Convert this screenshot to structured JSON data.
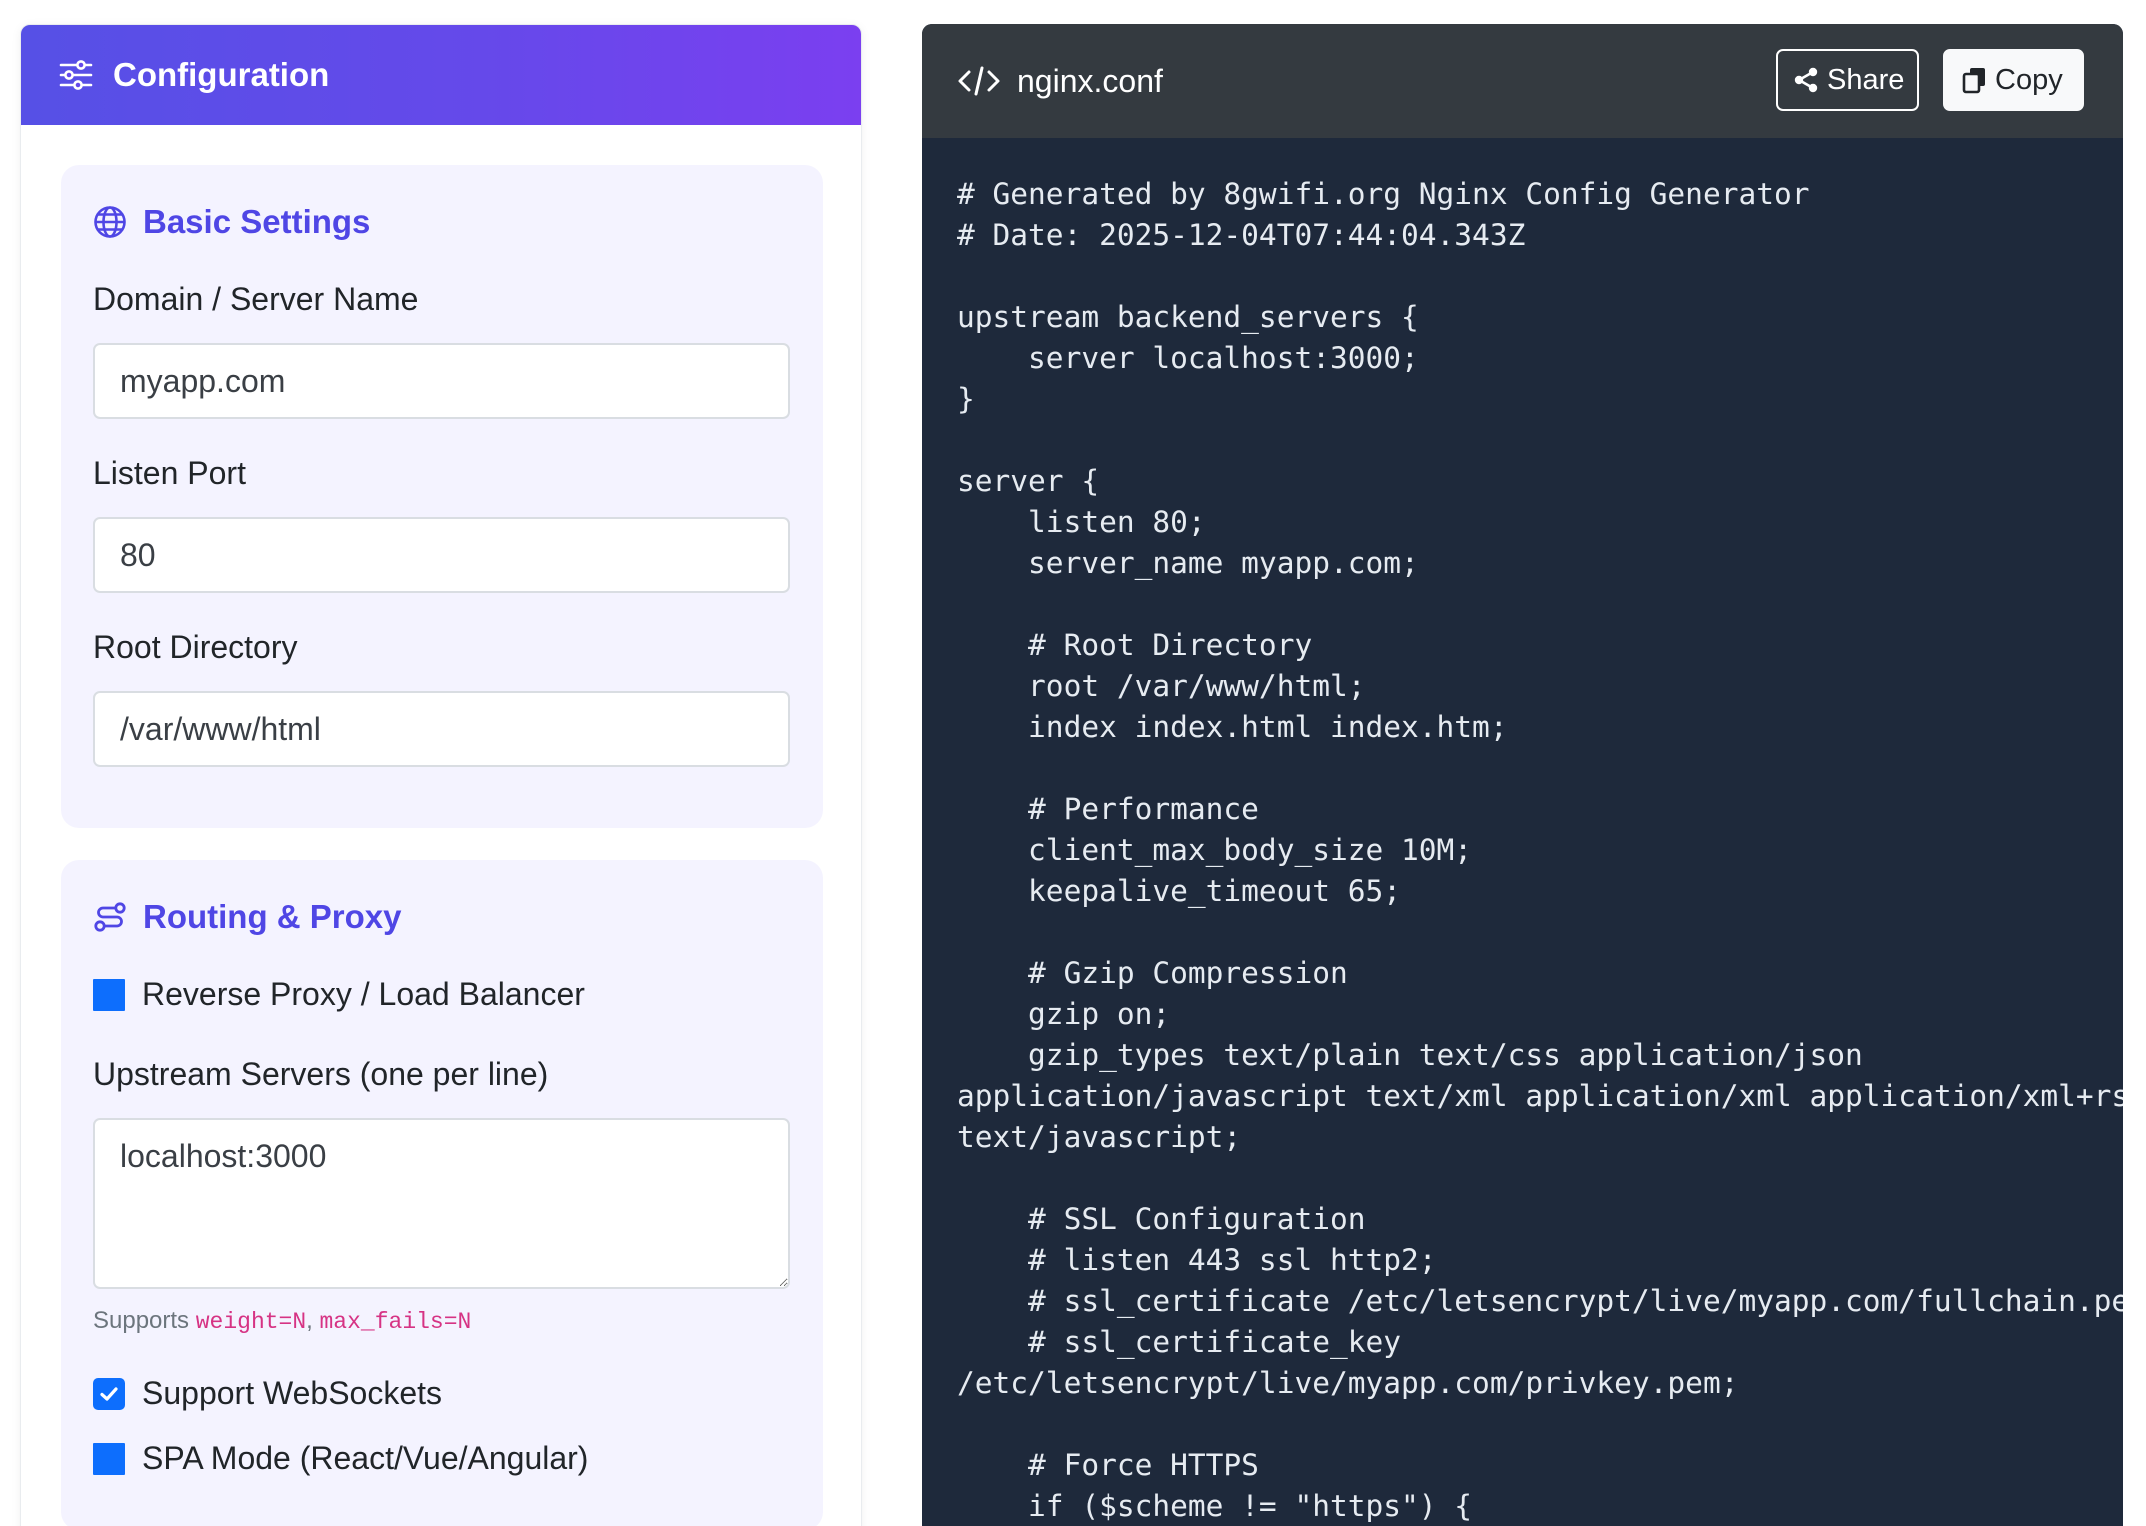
{
  "config": {
    "title": "Configuration",
    "basic": {
      "title": "Basic Settings",
      "domain_label": "Domain / Server Name",
      "domain_value": "myapp.com",
      "port_label": "Listen Port",
      "port_value": "80",
      "root_label": "Root Directory",
      "root_value": "/var/www/html"
    },
    "routing": {
      "title": "Routing & Proxy",
      "reverse_proxy_label": "Reverse Proxy / Load Balancer",
      "upstream_label": "Upstream Servers (one per line)",
      "upstream_value": "localhost:3000",
      "help_prefix": "Supports ",
      "help_code1": "weight=N",
      "help_sep": ", ",
      "help_code2": "max_fails=N",
      "websockets_label": "Support WebSockets",
      "websockets_checked": true,
      "spa_label": "SPA Mode (React/Vue/Angular)"
    }
  },
  "code": {
    "filename": "nginx.conf",
    "share_label": "Share",
    "copy_label": "Copy",
    "content": "# Generated by 8gwifi.org Nginx Config Generator\n# Date: 2025-12-04T07:44:04.343Z\n\nupstream backend_servers {\n    server localhost:3000;\n}\n\nserver {\n    listen 80;\n    server_name myapp.com;\n\n    # Root Directory\n    root /var/www/html;\n    index index.html index.htm;\n\n    # Performance\n    client_max_body_size 10M;\n    keepalive_timeout 65;\n\n    # Gzip Compression\n    gzip on;\n    gzip_types text/plain text/css application/json\napplication/javascript text/xml application/xml application/xml+rss\ntext/javascript;\n\n    # SSL Configuration\n    # listen 443 ssl http2;\n    # ssl_certificate /etc/letsencrypt/live/myapp.com/fullchain.pem;\n    # ssl_certificate_key\n/etc/letsencrypt/live/myapp.com/privkey.pem;\n\n    # Force HTTPS\n    if ($scheme != \"https\") {"
  },
  "icons": {
    "header": "sliders-icon",
    "basic": "globe-icon",
    "routing": "route-icon",
    "code": "code-icon",
    "share": "share-icon",
    "copy": "copy-icon",
    "check": "check-icon"
  },
  "colors": {
    "accent": "#4f46e5",
    "header_gradient_start": "#5650e6",
    "header_gradient_end": "#7b3ff0",
    "checkbox": "#0d6efd",
    "code_bg": "#1e293b",
    "code_header_bg": "#343a40",
    "help_code": "#d63384"
  }
}
